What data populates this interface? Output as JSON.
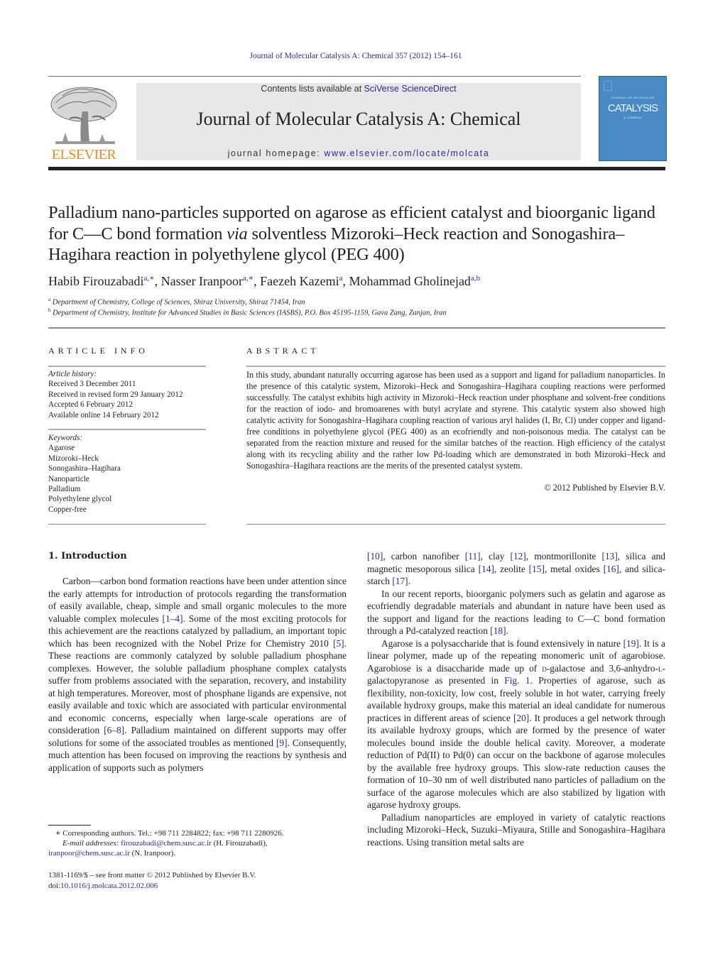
{
  "header": {
    "journal_ref": "Journal of Molecular Catalysis A: Chemical 357 (2012) 154–161",
    "contents_prefix": "Contents lists available at ",
    "contents_link": "SciVerse ScienceDirect",
    "journal_name": "Journal of Molecular Catalysis A: Chemical",
    "homepage_prefix": "journal homepage: ",
    "homepage_link": "www.elsevier.com/locate/molcata",
    "publisher_logo_text": "ELSEVIER",
    "cover_title": "CATALYSIS",
    "cover_sup": "JOURNAL OF MOLECULAR",
    "cover_sub": "A: CHEMICAL",
    "colors": {
      "link": "#2a2a8c",
      "elsevier_orange": "#f08a1c",
      "cover_blue": "#4a8ac4",
      "banner_gray": "#e8e8e8"
    }
  },
  "article": {
    "title_part1": "Palladium nano-particles supported on agarose as efficient catalyst and bioorganic ligand for C—C bond formation ",
    "title_italic": "via",
    "title_part2": " solventless Mizoroki–Heck reaction and Sonogashira–Hagihara reaction in polyethylene glycol (PEG 400)",
    "authors": [
      {
        "name": "Habib Firouzabadi",
        "sup": "a,∗",
        "sep": ", "
      },
      {
        "name": "Nasser Iranpoor",
        "sup": "a,∗",
        "sep": ", "
      },
      {
        "name": "Faezeh Kazemi",
        "sup": "a",
        "sep": ", "
      },
      {
        "name": "Mohammad Gholinejad",
        "sup": "a,b",
        "sep": ""
      }
    ],
    "affiliations": [
      {
        "mark": "a",
        "text": "Department of Chemistry, College of Sciences, Shiraz University, Shiraz 71454, Iran"
      },
      {
        "mark": "b",
        "text": "Department of Chemistry, Institute for Advanced Studies in Basic Sciences (IASBS), P.O. Box 45195-1159, Gava Zang, Zanjan, Iran"
      }
    ]
  },
  "article_info": {
    "label": "ARTICLE INFO",
    "history_heading": "Article history:",
    "history": [
      "Received 3 December 2011",
      "Received in revised form 29 January 2012",
      "Accepted 6 February 2012",
      "Available online 14 February 2012"
    ],
    "keywords_heading": "Keywords:",
    "keywords": [
      "Agarose",
      "Mizoroki–Heck",
      "Sonogashira–Hagihara",
      "Nanoparticle",
      "Palladium",
      "Polyethylene glycol",
      "Copper-free"
    ]
  },
  "abstract": {
    "label": "ABSTRACT",
    "text": "In this study, abundant naturally occurring agarose has been used as a support and ligand for palladium nanoparticles. In the presence of this catalytic system, Mizoroki–Heck and Sonogashira–Hagihara coupling reactions were performed successfully. The catalyst exhibits high activity in Mizoroki–Heck reaction under phosphane and solvent-free conditions for the reaction of iodo- and bromoarenes with butyl acrylate and styrene. This catalytic system also showed high catalytic activity for Sonogashira–Hagihara coupling reaction of various aryl halides (I, Br, Cl) under copper and ligand-free conditions in polyethylene glycol (PEG 400) as an ecofriendly and non-poisonous media. The catalyst can be separated from the reaction mixture and reused for the similar batches of the reaction. High efficiency of the catalyst along with its recycling ability and the rather low Pd-loading which are demonstrated in both Mizoroki–Heck and Sonogashira–Hagihara reactions are the merits of the presented catalyst system.",
    "copyright": "© 2012 Published by Elsevier B.V."
  },
  "introduction": {
    "heading": "1.  Introduction",
    "left": {
      "p1_a": "Carbon—carbon bond formation reactions have been under attention since the early attempts for introduction of protocols regarding the transformation of easily available, cheap, simple and small organic molecules to the more valuable complex molecules ",
      "ref_1_4": "[1–4]",
      "p1_b": ". Some of the most exciting protocols for this achievement are the reactions catalyzed by palladium, an important topic which has been recognized with the Nobel Prize for Chemistry 2010 ",
      "ref_5": "[5]",
      "p1_c": ". These reactions are commonly catalyzed by soluble palladium phosphane complexes. However, the soluble palladium phosphane complex catalysts suffer from problems associated with the separation, recovery, and instability at high temperatures. Moreover, most of phosphane ligands are expensive, not easily available and toxic which are associated with particular environmental and economic concerns, especially when large-scale operations are of consideration ",
      "ref_6_8": "[6–8]",
      "p1_d": ". Palladium maintained on different supports may offer solutions for some of the associated troubles as mentioned ",
      "ref_9": "[9]",
      "p1_e": ". Consequently, much attention has been focused on improving the reactions by synthesis and application of supports such as polymers"
    },
    "right": {
      "ref_10": "[10]",
      "t1": ", carbon nanofiber ",
      "ref_11": "[11]",
      "t2": ", clay ",
      "ref_12": "[12]",
      "t3": ", montmorillonite ",
      "ref_13": "[13]",
      "t4": ", silica and magnetic mesoporous silica ",
      "ref_14": "[14]",
      "t5": ", zeolite ",
      "ref_15": "[15]",
      "t6": ", metal oxides ",
      "ref_16": "[16]",
      "t7": ", and silica-starch ",
      "ref_17": "[17]",
      "t8": ".",
      "p2_a": "In our recent reports, bioorganic polymers such as gelatin and agarose as ecofriendly degradable materials and abundant in nature have been used as the support and ligand for the reactions leading to C—C bond formation through a Pd-catalyzed reaction ",
      "ref_18": "[18]",
      "p2_b": ".",
      "p3_a": "Agarose is a polysaccharide that is found extensively in nature ",
      "ref_19": "[19]",
      "p3_b": ". It is a linear polymer, made up of the repeating monomeric unit of agarobiose. Agarobiose is a disaccharide made up of ",
      "d_letter": "d",
      "p3_c": "-galactose and 3,6-anhydro-",
      "l_letter": "l",
      "p3_d": "-galactopyranose as presented in ",
      "fig_1": "Fig. 1",
      "p3_e": ". Properties of agarose, such as flexibility, non-toxicity, low cost, freely soluble in hot water, carrying freely available hydroxy groups, make this material an ideal candidate for numerous practices in different areas of science ",
      "ref_20": "[20]",
      "p3_f": ". It produces a gel network through its available hydroxy groups, which are formed by the presence of water molecules bound inside the double helical cavity. Moreover, a moderate reduction of Pd(II) to Pd(0) can occur on the backbone of agarose molecules by the available free hydroxy groups. This slow-rate reduction causes the formation of 10–30 nm of well distributed nano particles of palladium on the surface of the agarose molecules which are also stabilized by ligation with agarose hydroxy groups.",
      "p4": "Palladium nanoparticles are employed in variety of catalytic reactions including Mizoroki–Heck, Suzuki–Miyaura, Stille and Sonogashira–Hagihara reactions. Using transition metal salts are"
    }
  },
  "footnotes": {
    "corresponding": "∗  Corresponding authors. Tel.: +98 711 2284822; fax: +98 711 2280926.",
    "email_label": "E-mail addresses:",
    "email_1": "firouzabadi@chem.susc.ac.ir",
    "email_1_owner": " (H. Firouzabadi),",
    "email_2": "iranpoor@chem.susc.ac.ir",
    "email_2_owner": " (N. Iranpoor).",
    "issn_line": "1381-1169/$ – see front matter © 2012 Published by Elsevier B.V.",
    "doi_prefix": "doi:",
    "doi": "10.1016/j.molcata.2012.02.006"
  }
}
